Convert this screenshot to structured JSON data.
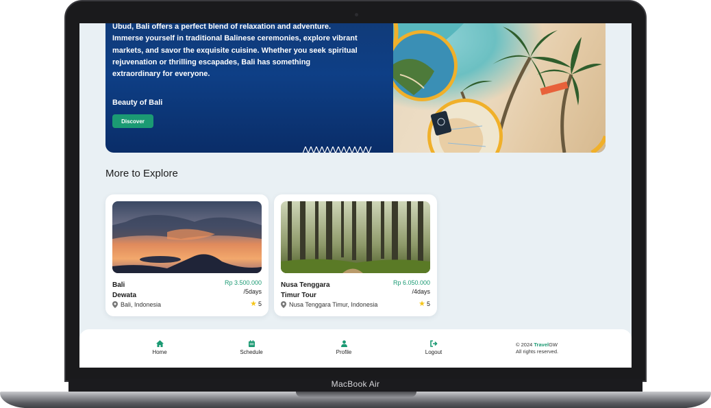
{
  "device": {
    "label": "MacBook Air"
  },
  "hero": {
    "paragraph": "From the stunning beaches of Kuta to the tranquil rice terraces of Ubud, Bali offers a perfect blend of relaxation and adventure. Immerse yourself in traditional Balinese ceremonies, explore vibrant markets, and savor the exquisite cuisine. Whether you seek spiritual rejuvenation or thrilling escapades, Bali has something extraordinary for everyone.",
    "title": "Beauty of Bali",
    "button_label": "Discover"
  },
  "explore": {
    "title": "More to Explore",
    "cards": [
      {
        "name_line1": "Bali",
        "name_line2": "Dewata",
        "price": "Rp 3.500.000",
        "duration": "/5days",
        "location": "Bali, Indonesia",
        "rating": "5"
      },
      {
        "name_line1": "Nusa Tenggara",
        "name_line2": "Timur Tour",
        "price": "Rp 6.050.000",
        "duration": "/4days",
        "location": "Nusa Tenggara Timur, Indonesia",
        "rating": "5"
      }
    ]
  },
  "nav": {
    "items": [
      {
        "label": "Home",
        "icon": "home-icon"
      },
      {
        "label": "Schedule",
        "icon": "schedule-icon"
      },
      {
        "label": "Profile",
        "icon": "profile-icon"
      },
      {
        "label": "Logout",
        "icon": "logout-icon"
      }
    ],
    "copyright_prefix": "© 2024 ",
    "brand_a": "Travel",
    "brand_b": "GW",
    "rights": "All rights reserved."
  },
  "colors": {
    "accent": "#1b9a73",
    "star": "#f5c518",
    "hero": "#0e3f86"
  }
}
